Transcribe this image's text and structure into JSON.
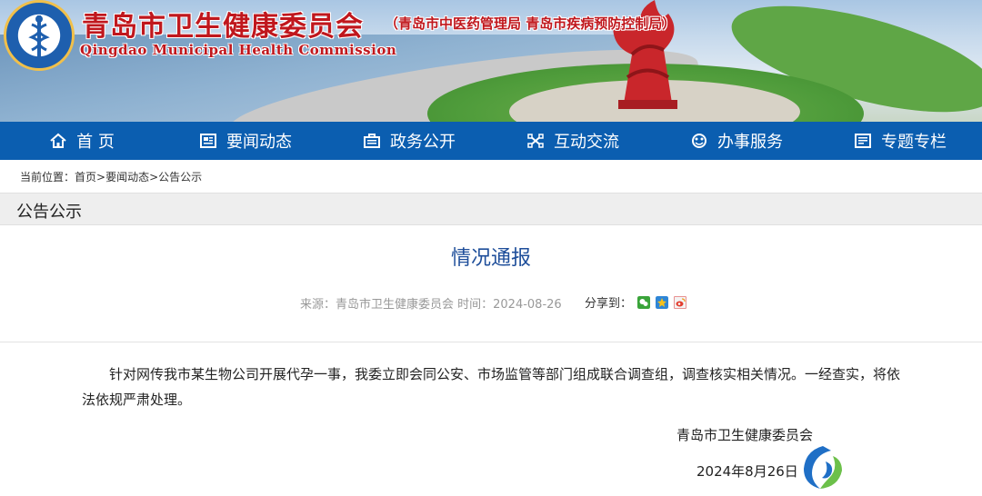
{
  "header": {
    "title": "青岛市卫生健康委员会",
    "subtitle": "（青岛市中医药管理局 青岛市疾病预防控制局）",
    "title_en": "Qingdao Municipal Health Commission"
  },
  "nav": {
    "items": [
      {
        "label": "首 页",
        "icon": "home-icon"
      },
      {
        "label": "要闻动态",
        "icon": "news-icon"
      },
      {
        "label": "政务公开",
        "icon": "briefcase-icon"
      },
      {
        "label": "互动交流",
        "icon": "interaction-icon"
      },
      {
        "label": "办事服务",
        "icon": "service-icon"
      },
      {
        "label": "专题专栏",
        "icon": "column-icon"
      }
    ]
  },
  "breadcrumb": {
    "prefix": "当前位置：",
    "items": [
      "首页",
      ">",
      "要闻动态",
      ">",
      "公告公示"
    ]
  },
  "section": {
    "label": "公告公示"
  },
  "article": {
    "title": "情况通报",
    "meta": "来源：青岛市卫生健康委员会  时间：2024-08-26",
    "share_label": "分享到：",
    "body": "针对网传我市某生物公司开展代孕一事，我委立即会同公安、市场监管等部门组成联合调查组，调查核实相关情况。一经查实，将依法依规严肃处理。",
    "signature": "青岛市卫生健康委员会",
    "date": "2024年8月26日"
  },
  "colors": {
    "nav_bg": "#0b5eb0",
    "title_red": "#c0171d",
    "article_title_blue": "#1e4e9a"
  }
}
